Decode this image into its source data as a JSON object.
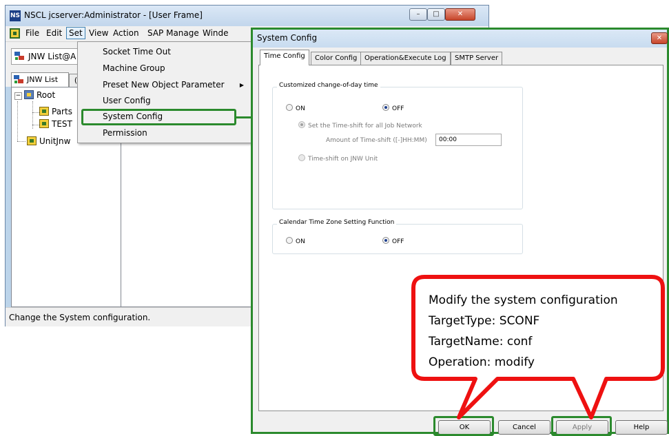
{
  "main_window": {
    "title": "NSCL jcserver:Administrator - [User Frame]",
    "app_icon": "NS",
    "caption": {
      "minimize": "–",
      "maximize": "□",
      "close": "✕"
    },
    "menubar": [
      "File",
      "Edit",
      "Set",
      "View",
      "Action",
      "SAP Manage",
      "Winde"
    ],
    "toolbar_combo_text": "JNW List@A",
    "tab_label": "JNW List",
    "tab_second_label": "(",
    "tree": {
      "root": "Root",
      "children": [
        "Parts",
        "TEST"
      ],
      "unit": "UnitJnw"
    },
    "status_text": "Change the System configuration."
  },
  "set_menu": {
    "items": [
      "Socket Time Out",
      "Machine Group",
      "Preset New Object Parameter",
      "User Config",
      "System Config",
      "Permission"
    ],
    "submenu_arrow": "▶"
  },
  "dialog": {
    "title": "System Config",
    "close": "✕",
    "tabs": [
      "Time Config",
      "Color Config",
      "Operation&Execute Log",
      "SMTP Server"
    ],
    "group1": {
      "legend": "Customized change-of-day time",
      "on_label": "ON",
      "off_label": "OFF",
      "selected": "OFF",
      "opt_all": "Set the Time-shift for all Job Network",
      "amount_label": "Amount of Time-shift ([-]HH:MM)",
      "amount_value": "00:00",
      "opt_unit": "Time-shift on JNW Unit"
    },
    "group2": {
      "legend": "Calendar Time Zone Setting Function",
      "on_label": "ON",
      "off_label": "OFF",
      "selected": "OFF"
    },
    "buttons": {
      "ok": "OK",
      "cancel": "Cancel",
      "apply": "Apply",
      "help": "Help"
    }
  },
  "callout": {
    "lines": [
      "Modify the system configuration",
      "TargetType: SCONF",
      "TargetName: conf",
      "Operation: modify"
    ]
  },
  "colors": {
    "highlight_green": "#2b8a2d",
    "callout_red": "#ee1111"
  }
}
